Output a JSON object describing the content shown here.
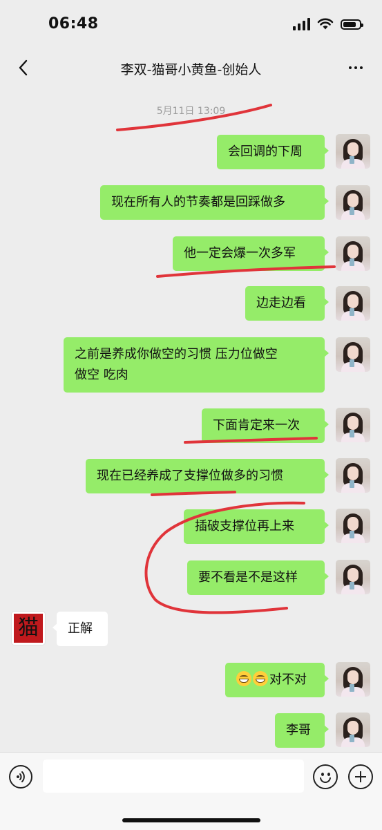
{
  "status_bar": {
    "time": "06:48"
  },
  "header": {
    "title": "李双-猫哥小黄鱼-创始人"
  },
  "chat": {
    "timestamp": "5月11日 13:09",
    "messages": [
      {
        "side": "right",
        "lines": [
          "会回调的下周"
        ]
      },
      {
        "side": "right",
        "lines": [
          "现在所有人的节奏都是回踩做多"
        ]
      },
      {
        "side": "right",
        "lines": [
          "他一定会爆一次多军"
        ]
      },
      {
        "side": "right",
        "lines": [
          "边走边看"
        ]
      },
      {
        "side": "right",
        "lines": [
          "之前是养成你做空的习惯 压力位做空",
          "做空 吃肉"
        ]
      },
      {
        "side": "right",
        "lines": [
          "下面肯定来一次"
        ]
      },
      {
        "side": "right",
        "lines": [
          "现在已经养成了支撑位做多的习惯"
        ]
      },
      {
        "side": "right",
        "lines": [
          "插破支撑位再上来"
        ]
      },
      {
        "side": "right",
        "lines": [
          "要不看是不是这样"
        ]
      },
      {
        "side": "left",
        "lines": [
          "正解"
        ]
      },
      {
        "side": "right",
        "lines": [
          "对不对"
        ],
        "emoji_prefix": 2
      },
      {
        "side": "right",
        "lines": [
          "李哥"
        ]
      }
    ]
  },
  "input_bar": {
    "value": ""
  },
  "colors": {
    "background": "#ededed",
    "bubble_self": "#95ec69",
    "bubble_other": "#ffffff",
    "annotation": "#e0343a"
  },
  "icons": [
    "back-chevron-icon",
    "more-dots-icon",
    "voice-icon",
    "emoji-icon",
    "plus-icon"
  ]
}
